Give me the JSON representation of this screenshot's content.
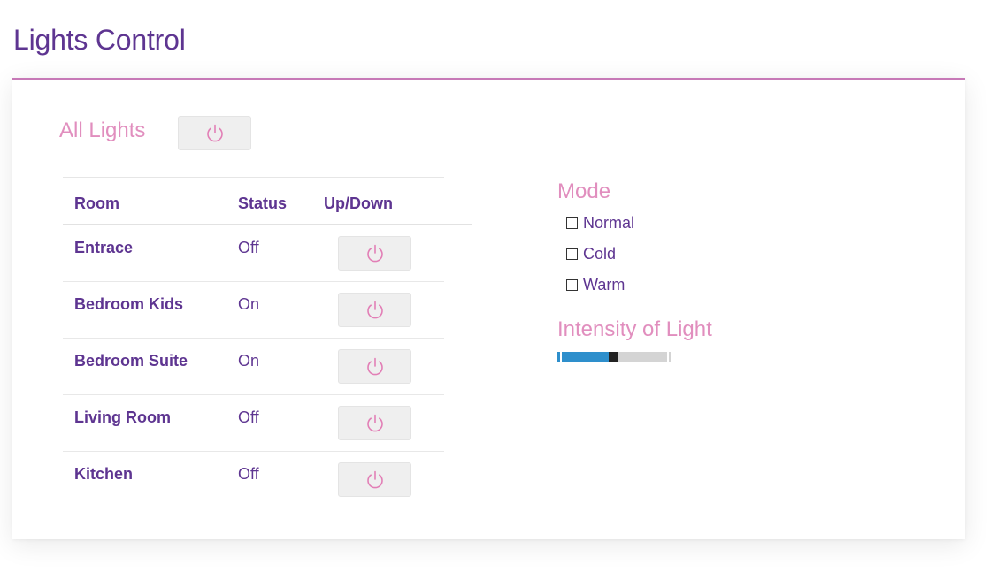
{
  "page": {
    "title": "Lights Control"
  },
  "all_lights": {
    "label": "All Lights",
    "button_icon": "power-icon"
  },
  "table": {
    "headers": {
      "room": "Room",
      "status": "Status",
      "updown": "Up/Down"
    },
    "rows": [
      {
        "room": "Entrace",
        "status": "Off"
      },
      {
        "room": "Bedroom Kids",
        "status": "On"
      },
      {
        "room": "Bedroom Suite",
        "status": "On"
      },
      {
        "room": "Living Room",
        "status": "Off"
      },
      {
        "room": "Kitchen",
        "status": "Off"
      }
    ]
  },
  "mode": {
    "title": "Mode",
    "options": [
      {
        "label": "Normal",
        "checked": false
      },
      {
        "label": "Cold",
        "checked": false
      },
      {
        "label": "Warm",
        "checked": false
      }
    ]
  },
  "intensity": {
    "title": "Intensity of Light",
    "value_fraction": 0.45
  },
  "colors": {
    "title": "#5e3591",
    "accent_pink": "#e18ebe",
    "card_border": "#c779b7",
    "power_icon": "#e27fb6",
    "slider_fill": "#2e8fcc"
  }
}
